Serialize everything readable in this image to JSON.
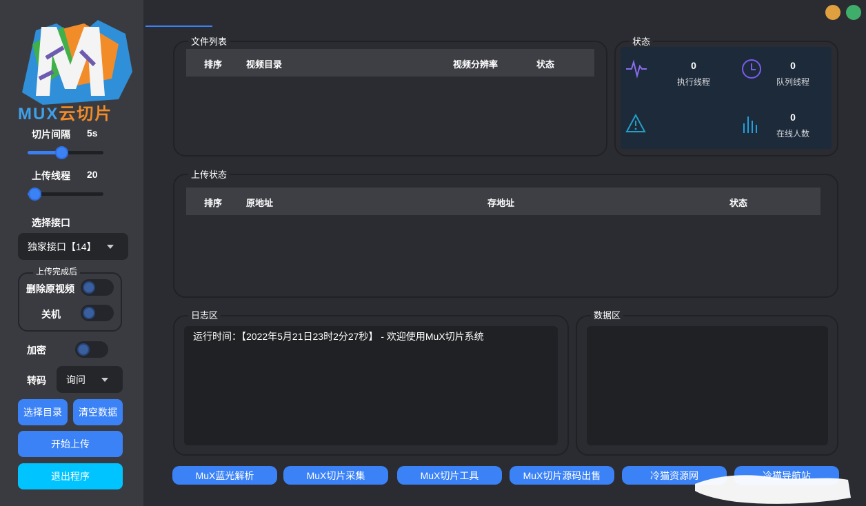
{
  "brand": {
    "name_latin": "MUX",
    "name_cn": "云切片"
  },
  "settings": {
    "slice_interval_label": "切片间隔",
    "slice_interval_value": "5s",
    "slice_interval_fraction": 0.45,
    "upload_threads_label": "上传线程",
    "upload_threads_value": "20",
    "upload_threads_fraction": 0.1,
    "select_api_label": "选择接口",
    "select_api_value": "独家接口【14】",
    "after_upload_title": "上传完成后",
    "delete_source_label": "删除原视频",
    "shutdown_label": "关机",
    "encrypt_label": "加密",
    "transcode_label": "转码",
    "transcode_value": "询问"
  },
  "buttons": {
    "select_dir": "选择目录",
    "clear_data": "清空数据",
    "start_upload": "开始上传",
    "exit": "退出程序"
  },
  "file_list": {
    "title": "文件列表",
    "columns": [
      "排序",
      "视频目录",
      "视频分辨率",
      "状态"
    ]
  },
  "status": {
    "title": "状态",
    "exec_threads_value": "0",
    "exec_threads_label": "执行线程",
    "queue_threads_value": "0",
    "queue_threads_label": "队列线程",
    "online_value": "0",
    "online_label": "在线人数"
  },
  "upload_status": {
    "title": "上传状态",
    "columns": [
      "排序",
      "原地址",
      "存地址",
      "状态"
    ]
  },
  "log": {
    "title": "日志区",
    "line": "运行时间：【2022年5月21日23时2分27秒】 - 欢迎使用MuX切片系统"
  },
  "data_area": {
    "title": "数据区"
  },
  "bottom_links": [
    "MuX蓝光解析",
    "MuX切片采集",
    "MuX切片工具",
    "MuX切片源码出售",
    "冷猫资源网",
    "冷猫导航站"
  ],
  "colors": {
    "accent": "#3b82f6",
    "exit": "#00c4ff",
    "win_min": "#e0a040",
    "win_close": "#3fae6a"
  }
}
